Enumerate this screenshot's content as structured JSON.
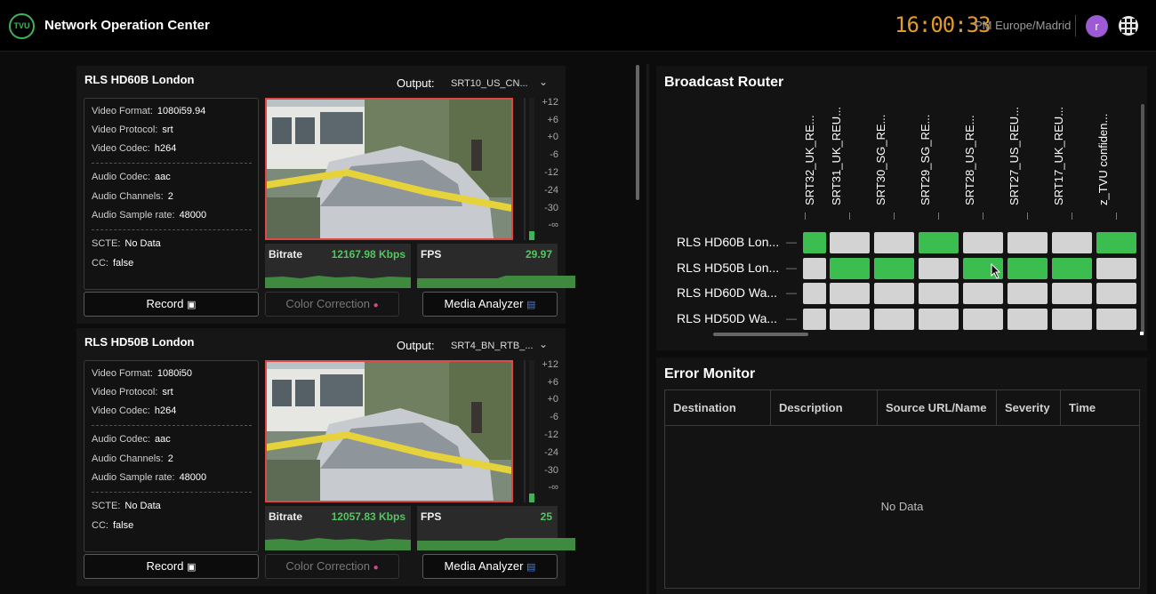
{
  "header": {
    "logo_text": "TVU",
    "title": "Network Operation Center",
    "clock": "16:00:33",
    "timezone": "PM Europe/Madrid",
    "avatar_initial": "r"
  },
  "sources": [
    {
      "title": "RLS HD60B London",
      "output_label": "Output:",
      "output_value": "SRT10_US_CN...",
      "meta": [
        {
          "label": "Video Format:",
          "value": "1080i59.94"
        },
        {
          "label": "Video Protocol:",
          "value": "srt"
        },
        {
          "label": "Video Codec:",
          "value": "h264"
        },
        {
          "label": "Audio Codec:",
          "value": "aac"
        },
        {
          "label": "Audio Channels:",
          "value": "2"
        },
        {
          "label": "Audio Sample rate:",
          "value": "48000"
        },
        {
          "label": "SCTE:",
          "value": "No Data"
        },
        {
          "label": "CC:",
          "value": "false"
        }
      ],
      "vu_scale": [
        "+12",
        "+6",
        "+0",
        "-6",
        "-12",
        "-24",
        "-30",
        "-∞"
      ],
      "audio_level": 0.06,
      "bitrate_label": "Bitrate",
      "bitrate_value": "12167.98 Kbps",
      "fps_label": "FPS",
      "fps_value": "29.97",
      "record_label": "Record",
      "color_correction_label": "Color Correction",
      "media_analyzer_label": "Media Analyzer"
    },
    {
      "title": "RLS HD50B London",
      "output_label": "Output:",
      "output_value": "SRT4_BN_RTB_...",
      "meta": [
        {
          "label": "Video Format:",
          "value": "1080i50"
        },
        {
          "label": "Video Protocol:",
          "value": "srt"
        },
        {
          "label": "Video Codec:",
          "value": "h264"
        },
        {
          "label": "Audio Codec:",
          "value": "aac"
        },
        {
          "label": "Audio Channels:",
          "value": "2"
        },
        {
          "label": "Audio Sample rate:",
          "value": "48000"
        },
        {
          "label": "SCTE:",
          "value": "No Data"
        },
        {
          "label": "CC:",
          "value": "false"
        }
      ],
      "vu_scale": [
        "+12",
        "+6",
        "+0",
        "-6",
        "-12",
        "-24",
        "-30",
        "-∞"
      ],
      "audio_level": 0.06,
      "bitrate_label": "Bitrate",
      "bitrate_value": "12057.83 Kbps",
      "fps_label": "FPS",
      "fps_value": "25",
      "record_label": "Record",
      "color_correction_label": "Color Correction",
      "media_analyzer_label": "Media Analyzer"
    }
  ],
  "router": {
    "title": "Broadcast Router",
    "columns": [
      "SRT32_UK_RE...",
      "SRT31_UK_REU...",
      "SRT30_SG_RE...",
      "SRT29_SG_RE...",
      "SRT28_US_RE...",
      "SRT27_US_REU...",
      "SRT17_UK_REU...",
      "z_TVU confiden..."
    ],
    "rows": [
      {
        "label": "RLS HD60B Lon...",
        "cells": [
          1,
          0,
          0,
          1,
          0,
          0,
          0,
          1
        ]
      },
      {
        "label": "RLS HD50B Lon...",
        "cells": [
          0,
          1,
          1,
          0,
          1,
          1,
          1,
          0
        ]
      },
      {
        "label": "RLS HD60D Wa...",
        "cells": [
          0,
          0,
          0,
          0,
          0,
          0,
          0,
          0
        ]
      },
      {
        "label": "RLS HD50D Wa...",
        "cells": [
          0,
          0,
          0,
          0,
          0,
          0,
          0,
          0
        ]
      }
    ],
    "colors": {
      "on": "#3cbd4f",
      "off": "#d3d3d3"
    }
  },
  "error_monitor": {
    "title": "Error Monitor",
    "columns": [
      "Destination",
      "Description",
      "Source URL/Name",
      "Severity",
      "Time"
    ],
    "empty_text": "No Data"
  }
}
